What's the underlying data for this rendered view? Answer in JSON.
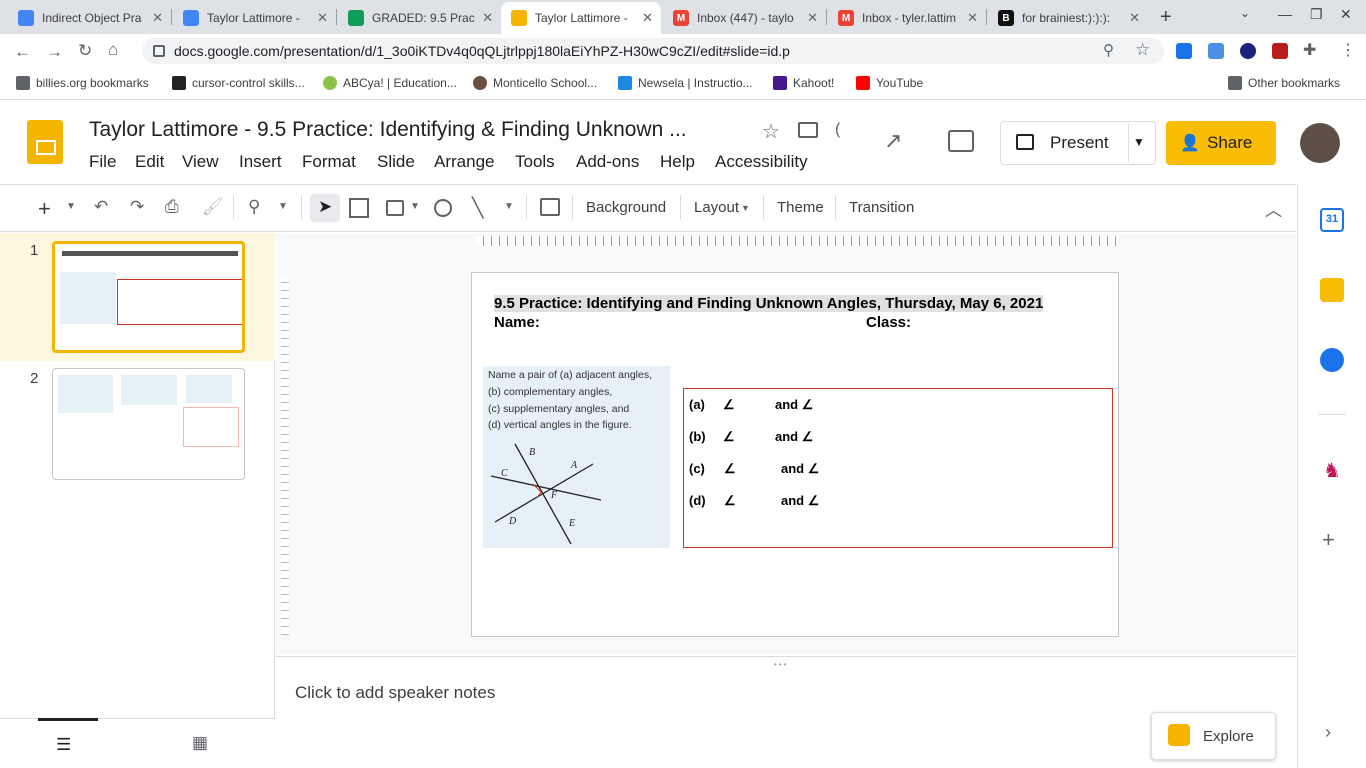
{
  "browser": {
    "tabs": [
      {
        "title": "Indirect Object Pra",
        "favicon": "docs-icon",
        "color": "#4285f4"
      },
      {
        "title": "Taylor Lattimore -",
        "favicon": "docs-icon",
        "color": "#4285f4"
      },
      {
        "title": "GRADED: 9.5 Prac",
        "favicon": "classroom-icon",
        "color": "#0f9d58"
      },
      {
        "title": "Taylor Lattimore -",
        "favicon": "slides-icon",
        "color": "#f4b400"
      },
      {
        "title": "Inbox (447) - taylo",
        "favicon": "gmail-icon",
        "color": "#ea4335"
      },
      {
        "title": "Inbox - tyler.lattim",
        "favicon": "gmail-icon",
        "color": "#ea4335"
      },
      {
        "title": "for brainiest:):):):",
        "favicon": "brainly-icon",
        "color": "#111111"
      }
    ],
    "url": "docs.google.com/presentation/d/1_3o0iKTDv4q0qQLjtrlppj180laEiYhPZ-H30wC9cZI/edit#slide=id.p",
    "bookmarks": [
      "billies.org bookmarks",
      "cursor-control skills...",
      "ABCya! | Education...",
      "Monticello School...",
      "Newsela | Instructio...",
      "Kahoot!",
      "YouTube"
    ],
    "other_bookmarks": "Other bookmarks"
  },
  "app": {
    "doc_title": "Taylor Lattimore - 9.5 Practice:  Identifying  & Finding Unknown ...",
    "menu": [
      "File",
      "Edit",
      "View",
      "Insert",
      "Format",
      "Slide",
      "Arrange",
      "Tools",
      "Add-ons",
      "Help",
      "Accessibility"
    ],
    "present_label": "Present",
    "share_label": "Share"
  },
  "toolbar": {
    "background": "Background",
    "layout": "Layout",
    "theme": "Theme",
    "transition": "Transition"
  },
  "filmstrip": {
    "slides": [
      "1",
      "2"
    ]
  },
  "slide": {
    "title": "9.5 Practice:  Identifying and Finding Unknown Angles, Thursday, May 6, 2021",
    "name_label": "Name:",
    "class_label": "Class:",
    "figure_text": [
      "Name a pair of (a) adjacent angles,",
      "(b) complementary angles,",
      "(c) supplementary angles, and",
      "(d) vertical angles in the figure."
    ],
    "figure_points": [
      "A",
      "B",
      "C",
      "D",
      "E",
      "F"
    ],
    "answers": [
      {
        "label": "(a)",
        "angle": "∠",
        "and": "and ∠"
      },
      {
        "label": "(b)",
        "angle": "∠",
        "and": "and ∠"
      },
      {
        "label": "(c)",
        "angle": "∠",
        "and": "and ∠"
      },
      {
        "label": "(d)",
        "angle": "∠",
        "and": "and ∠"
      }
    ]
  },
  "notes_placeholder": "Click to add speaker notes",
  "explore_label": "Explore",
  "calendar_label": "31"
}
